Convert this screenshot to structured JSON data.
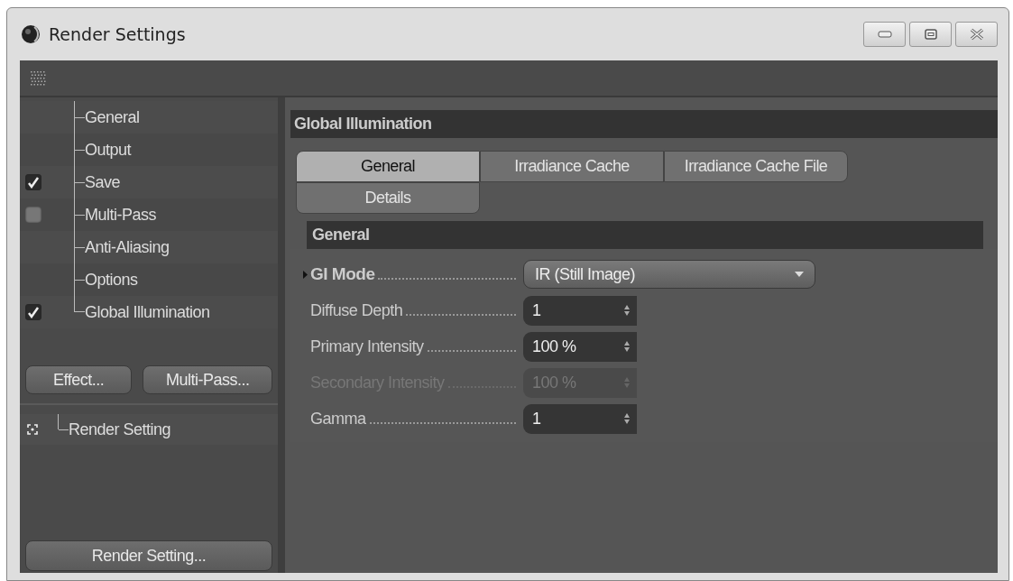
{
  "window": {
    "title": "Render Settings"
  },
  "tree": {
    "items": [
      {
        "label": "General",
        "kind": "plain"
      },
      {
        "label": "Output",
        "kind": "plain"
      },
      {
        "label": "Save",
        "kind": "checkbox",
        "checked": true
      },
      {
        "label": "Multi-Pass",
        "kind": "checkbox",
        "checked": false
      },
      {
        "label": "Anti-Aliasing",
        "kind": "plain"
      },
      {
        "label": "Options",
        "kind": "plain"
      },
      {
        "label": "Global Illumination",
        "kind": "checkbox",
        "checked": true
      }
    ]
  },
  "tree_buttons": [
    "Effect...",
    "Multi-Pass..."
  ],
  "render_settings": [
    {
      "label": "Render Setting"
    }
  ],
  "bottom_button": "Render Setting...",
  "panel": {
    "title": "Global Illumination",
    "tabs": [
      {
        "label": "General",
        "selected": true
      },
      {
        "label": "Irradiance Cache",
        "selected": false
      },
      {
        "label": "Irradiance Cache File",
        "selected": false
      },
      {
        "label": "Details",
        "selected": false
      }
    ],
    "group": {
      "title": "General",
      "params": [
        {
          "label": "GI Mode",
          "kind": "dropdown",
          "value": "IR (Still Image)",
          "disabled": false,
          "expandable": true
        },
        {
          "label": "Diffuse Depth",
          "kind": "spinner",
          "value": "1",
          "disabled": false,
          "expandable": false
        },
        {
          "label": "Primary Intensity",
          "kind": "spinner",
          "value": "100 %",
          "disabled": false,
          "expandable": false
        },
        {
          "label": "Secondary Intensity",
          "kind": "spinner",
          "value": "100 %",
          "disabled": true,
          "expandable": false
        },
        {
          "label": "Gamma",
          "kind": "spinner",
          "value": "1",
          "disabled": false,
          "expandable": false
        }
      ]
    }
  }
}
